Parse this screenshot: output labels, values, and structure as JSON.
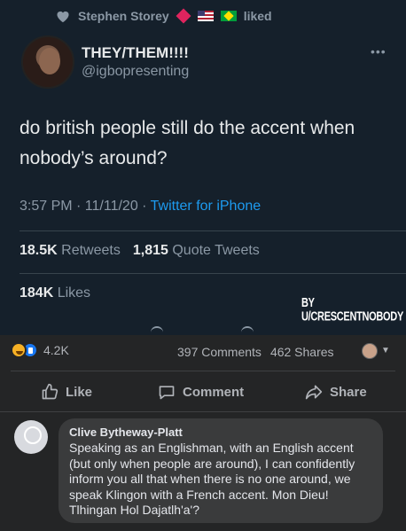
{
  "twitter": {
    "liked_by": "Stephen Storey",
    "liked_suffix": "liked",
    "display_name": "THEY/THEM!!!!",
    "handle": "@igbopresenting",
    "more_icon": "ellipsis-icon",
    "tweet_text": "do british people still do the accent when nobody’s around?",
    "time": "3:57 PM · 11/11/20 ·",
    "source": "Twitter for iPhone",
    "retweets_count": "18.5K",
    "retweets_label": "Retweets",
    "quotes_count": "1,815",
    "quotes_label": "Quote Tweets",
    "likes_count": "184K",
    "likes_label": "Likes",
    "watermark": "BY U/CRESCENTNOBODY",
    "colors": {
      "background": "#15202b",
      "link": "#1d9bf0",
      "muted": "#8b98a5"
    }
  },
  "facebook": {
    "reactions_count": "4.2K",
    "comments": "397 Comments",
    "shares": "462 Shares",
    "actions": {
      "like": "Like",
      "comment": "Comment",
      "share": "Share"
    },
    "comment": {
      "author": "Clive Bytheway-Platt",
      "text": "Speaking as an Englishman, with an English accent (but only when people are around), I can confidently inform you all that when there is no one around, we speak Klingon with a French accent. Mon Dieu! Tlhingan Hol Dajatlh'a'?"
    },
    "colors": {
      "background": "#242526",
      "bubble": "#3a3b3c",
      "text": "#e4e6eb",
      "muted": "#b0b3b8"
    }
  }
}
